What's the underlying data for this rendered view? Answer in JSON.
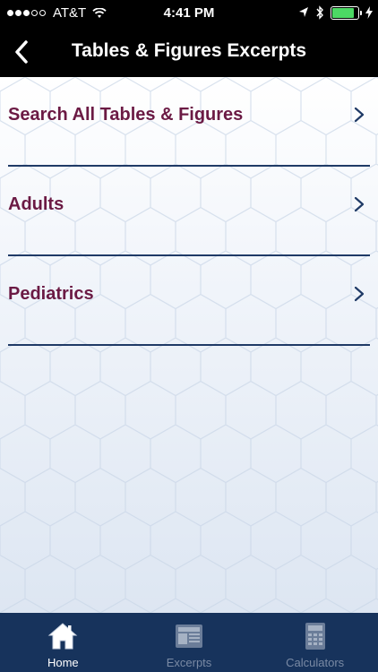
{
  "status_bar": {
    "carrier": "AT&T",
    "time": "4:41 PM",
    "signal_bars_filled": 3,
    "signal_bars_total": 5,
    "battery_level": 0.85
  },
  "nav": {
    "title": "Tables & Figures Excerpts",
    "back_icon": "chevron-left-icon"
  },
  "menu": {
    "items": [
      {
        "label": "Search All Tables & Figures"
      },
      {
        "label": "Adults"
      },
      {
        "label": "Pediatrics"
      }
    ]
  },
  "tabs": {
    "items": [
      {
        "label": "Home",
        "icon": "home-icon",
        "active": true
      },
      {
        "label": "Excerpts",
        "icon": "newspaper-icon",
        "active": false
      },
      {
        "label": "Calculators",
        "icon": "calculator-icon",
        "active": false
      }
    ]
  },
  "colors": {
    "menu_text": "#6b1a44",
    "divider": "#1f3a66",
    "tab_bar": "#17335c",
    "battery": "#4cd964"
  }
}
